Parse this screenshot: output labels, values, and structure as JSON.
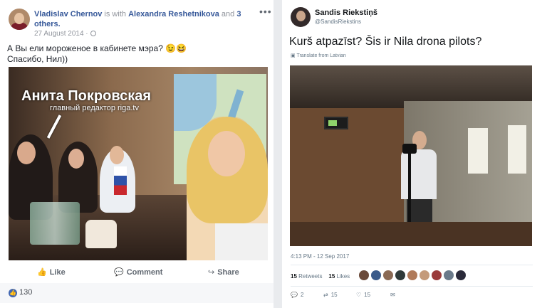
{
  "facebook": {
    "author": "Vladislav Chernov",
    "with_text": " is with ",
    "tagged": "Alexandra Reshetnikova",
    "and_text": " and ",
    "others": "3 others.",
    "date": "27 August 2014 ·",
    "text_line1": "А Вы ели мороженое в кабинете мэра? 😉😆",
    "text_line2": "Спасибо, Нил))",
    "photo_overlay_name": "Анита Покровская",
    "photo_overlay_role": "главный редактор riga.tv",
    "actions": {
      "like": "Like",
      "comment": "Comment",
      "share": "Share"
    },
    "like_count": "130"
  },
  "twitter": {
    "name": "Sandis Riekstiņš",
    "handle": "@SandisRiekstins",
    "text": "Kurš atpazīst? Šis ir Nila drona pilots?",
    "translate": "Translate from Latvian",
    "timestamp": "4:13 PM - 12 Sep 2017",
    "retweets_num": "15",
    "retweets_label": " Retweets",
    "likes_num": "15",
    "likes_label": " Likes",
    "reply_count": "2",
    "retweet_count": "15",
    "like_count": "15",
    "liker_colors": [
      "#6b4a3a",
      "#3b5b8a",
      "#8a6a55",
      "#2f3a3a",
      "#b07a5a",
      "#c49a7a",
      "#9a3a3a",
      "#6a7a8a",
      "#2a2a3a"
    ]
  }
}
